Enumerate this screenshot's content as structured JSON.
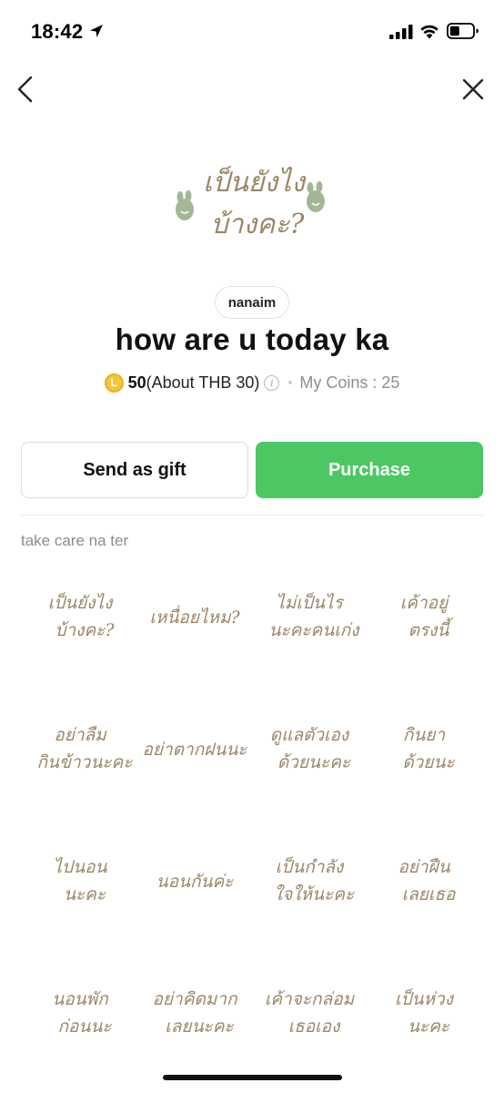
{
  "status_bar": {
    "time": "18:42"
  },
  "pack": {
    "author": "nanaim",
    "title": "how are u today ka",
    "price": "50",
    "price_about": "(About THB 30)",
    "coin_letter": "L",
    "my_coins": "My Coins : 25",
    "description": "take care na ter"
  },
  "buttons": {
    "gift": "Send as gift",
    "purchase": "Purchase"
  },
  "colors": {
    "accent_green": "#4cc764",
    "sticker_brown": "#9c8667",
    "sticker_green": "#a3b797",
    "coin_gold": "#f4c43a"
  },
  "hero_sticker": {
    "line1": "เป็นยังไง",
    "line2": "บ้างคะ?"
  },
  "stickers": [
    {
      "line1": "เป็นยังไง",
      "line2": "บ้างคะ?"
    },
    {
      "line1": "เหนื่อยไหม?",
      "line2": ""
    },
    {
      "line1": "ไม่เป็นไร",
      "line2": "นะคะคนเก่ง"
    },
    {
      "line1": "เค้าอยู่",
      "line2": "ตรงนี้"
    },
    {
      "line1": "อย่าลืม",
      "line2": "กินข้าวนะคะ"
    },
    {
      "line1": "อย่าตากฝนนะ",
      "line2": ""
    },
    {
      "line1": "ดูแลตัวเอง",
      "line2": "ด้วยนะคะ"
    },
    {
      "line1": "กินยา",
      "line2": "ด้วยนะ"
    },
    {
      "line1": "ไปนอน",
      "line2": "นะคะ"
    },
    {
      "line1": "นอนกันค่ะ",
      "line2": ""
    },
    {
      "line1": "เป็นกำลัง",
      "line2": "ใจให้นะคะ"
    },
    {
      "line1": "อย่าฝืน",
      "line2": "เลยเธอ"
    },
    {
      "line1": "นอนพัก",
      "line2": "ก่อนนะ"
    },
    {
      "line1": "อย่าคิดมาก",
      "line2": "เลยนะคะ"
    },
    {
      "line1": "เค้าจะกล่อม",
      "line2": "เธอเอง"
    },
    {
      "line1": "เป็นห่วง",
      "line2": "นะคะ"
    }
  ]
}
